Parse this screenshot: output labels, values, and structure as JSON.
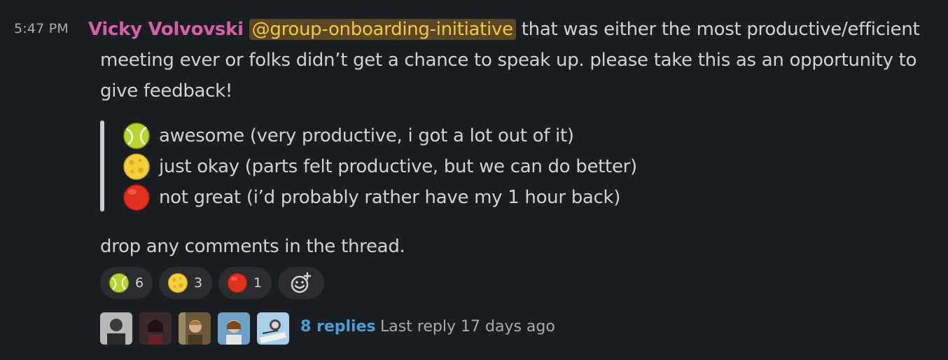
{
  "message": {
    "timestamp": "5:47 PM",
    "author": "Vicky Volvovski",
    "mention": "@group-onboarding-initiative",
    "text_line1": " that was either the most productive/efficient",
    "text_line2": "meeting ever or folks didn’t get a chance to speak up. please take this as an opportunity to",
    "text_line3": "give feedback!",
    "options": [
      {
        "emoji": "tennis-ball",
        "text": "awesome (very productive, i got a lot out of it)"
      },
      {
        "emoji": "moon",
        "text": "just okay (parts felt productive, but we can do better)"
      },
      {
        "emoji": "red-circle",
        "text": "not great (i’d probably rather have my 1 hour back)"
      }
    ],
    "footer_text": "drop any comments in the thread."
  },
  "reactions": [
    {
      "emoji": "tennis-ball",
      "count": "6"
    },
    {
      "emoji": "moon",
      "count": "3"
    },
    {
      "emoji": "red-circle",
      "count": "1"
    }
  ],
  "add_reaction_icon": "add-emoji-icon",
  "thread": {
    "avatars": [
      "avatar-1",
      "avatar-2",
      "avatar-3",
      "avatar-4",
      "avatar-5"
    ],
    "replies": "8 replies",
    "last_reply": "Last reply 17 days ago"
  },
  "colors": {
    "background": "#1a1d21",
    "author": "#d65fa8",
    "mention_bg": "#5b4726",
    "mention_text": "#f2c744",
    "link": "#4a9fd8"
  }
}
